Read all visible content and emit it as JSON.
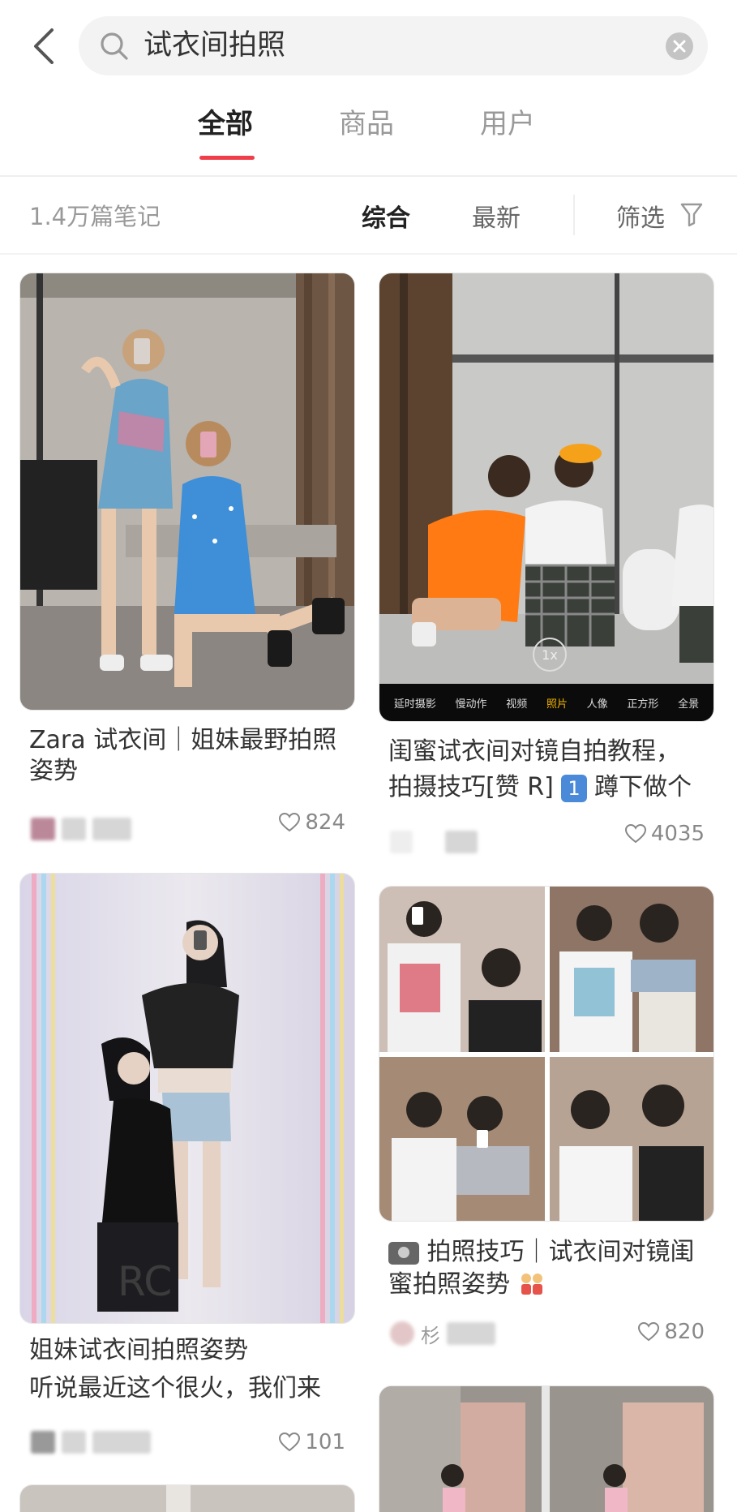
{
  "search": {
    "query": "试衣间拍照",
    "back_icon": "chevron-left-icon",
    "clear_icon": "clear-circle-icon"
  },
  "tabs": [
    {
      "label": "全部",
      "active": true
    },
    {
      "label": "商品",
      "active": false
    },
    {
      "label": "用户",
      "active": false
    }
  ],
  "filter_bar": {
    "count": "1.4万篇笔记",
    "sort_options": [
      {
        "label": "综合",
        "active": true
      },
      {
        "label": "最新",
        "active": false
      }
    ],
    "filter_label": "筛选"
  },
  "colors": {
    "accent": "#ef3e4a"
  },
  "camera_modes": [
    "延时摄影",
    "慢动作",
    "视频",
    "照片",
    "人像",
    "正方形",
    "全景"
  ],
  "camera_selected": "照片",
  "camera_slot_label": "1x",
  "cards": [
    {
      "title": "Zara 试衣间｜姐妹最野拍照姿势",
      "likes": "824"
    },
    {
      "title_line1": "闺蜜试衣间对镜自拍教程，",
      "title_line2_text": "拍摄技巧[赞 R]",
      "title_line2_badge": "1",
      "title_line2_tail": "蹲下做个",
      "likes": "4035"
    },
    {
      "title": "姐妹试衣间拍照姿势",
      "subtitle": "听说最近这个很火，我们来",
      "likes": "101"
    },
    {
      "title_text": "拍照技巧｜试衣间对镜闺蜜拍照姿势",
      "author_initial": "杉",
      "likes": "820"
    }
  ]
}
